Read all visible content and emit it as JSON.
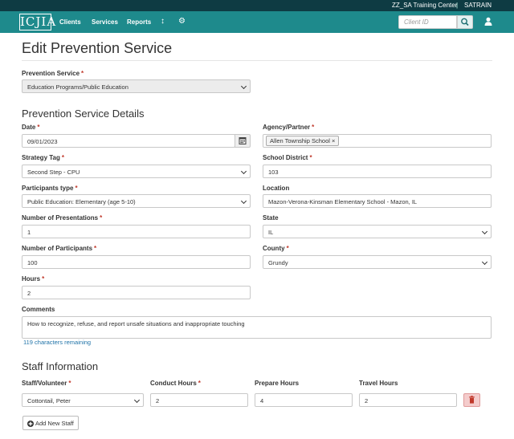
{
  "topbar": {
    "center": "ZZ_SA Training Center",
    "separator": "|",
    "user": "SATRAIN"
  },
  "nav": {
    "logo": "ICJIA",
    "links": [
      "Clients",
      "Services",
      "Reports"
    ],
    "sort_icon": "↕",
    "settings_icon": "⚙",
    "client_placeholder": "Client ID",
    "icons": [
      "sort-icon",
      "gear-icon",
      "search-icon",
      "user-icon"
    ]
  },
  "page": {
    "title": "Edit Prevention Service",
    "service_label": "Prevention Service",
    "service_value": "Education Programs/Public Education",
    "details_heading": "Prevention Service Details"
  },
  "form": {
    "date_label": "Date",
    "date_value": "09/01/2023",
    "agency_label": "Agency/Partner",
    "agency_tag": "Allen Township School",
    "tag_remove": "×",
    "strategy_label": "Strategy Tag",
    "strategy_value": "Second Step - CPU",
    "district_label": "School District",
    "district_value": "103",
    "participants_type_label": "Participants type",
    "participants_type_value": "Public Education: Elementary (age 5-10)",
    "location_label": "Location",
    "location_value": "Mazon-Verona-Kinsman Elementary School - Mazon, IL",
    "presentations_label": "Number of Presentations",
    "presentations_value": "1",
    "state_label": "State",
    "state_value": "IL",
    "participants_label": "Number of Participants",
    "participants_value": "100",
    "county_label": "County",
    "county_value": "Grundy",
    "hours_label": "Hours",
    "hours_value": "2",
    "comments_label": "Comments",
    "comments_value": "How to recognize, refuse, and report unsafe situations and inappropriate touching",
    "chars_remaining": "119 characters remaining",
    "required_mark": "*"
  },
  "staff": {
    "heading": "Staff Information",
    "staff_label": "Staff/Volunteer",
    "conduct_label": "Conduct Hours",
    "prepare_label": "Prepare Hours",
    "travel_label": "Travel Hours",
    "staff_value": "Cottontail, Peter",
    "conduct_value": "2",
    "prepare_value": "4",
    "travel_value": "2",
    "add_label": "Add New Staff"
  },
  "colors": {
    "topbar": "#0e3b43",
    "navbar": "#1e8a8c",
    "required": "#c0392b",
    "link": "#1f73a8",
    "danger": "#f4cccc"
  }
}
